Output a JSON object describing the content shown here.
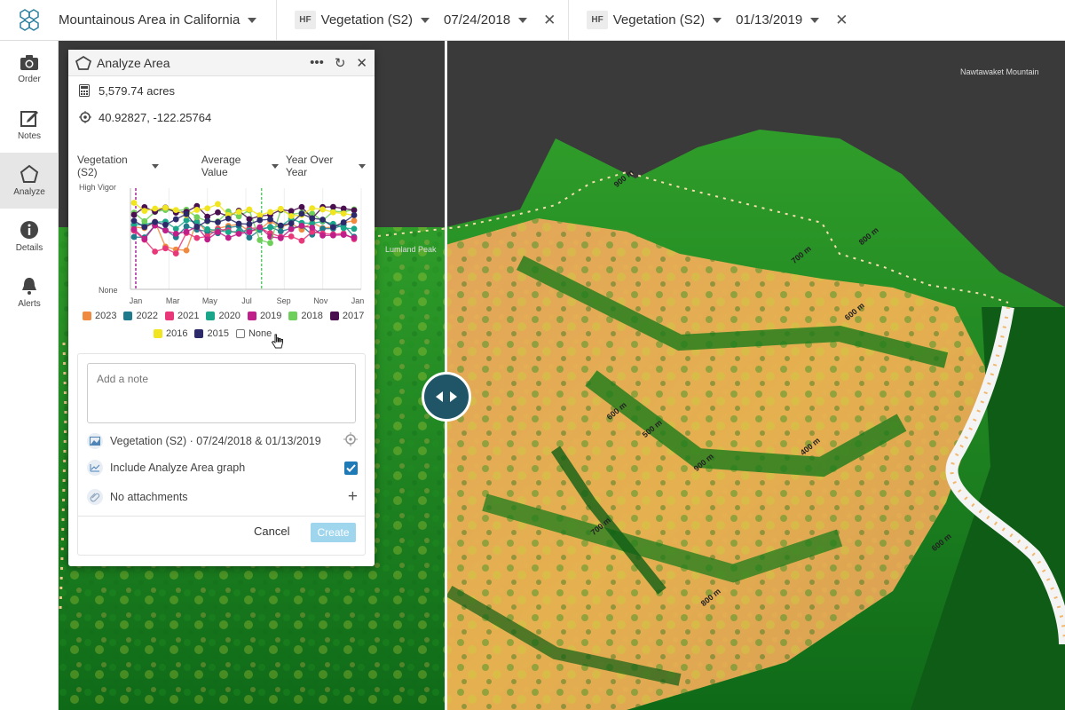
{
  "topbar": {
    "area_name": "Mountainous Area in California",
    "layers": [
      {
        "tag": "HF",
        "name": "Vegetation (S2)",
        "date": "07/24/2018"
      },
      {
        "tag": "HF",
        "name": "Vegetation (S2)",
        "date": "01/13/2019"
      }
    ]
  },
  "sidenav": {
    "items": [
      {
        "label": "Order",
        "icon": "camera-icon"
      },
      {
        "label": "Notes",
        "icon": "edit-icon"
      },
      {
        "label": "Analyze",
        "icon": "pentagon-icon"
      },
      {
        "label": "Details",
        "icon": "info-icon"
      },
      {
        "label": "Alerts",
        "icon": "bell-icon"
      }
    ]
  },
  "map": {
    "peak_labels": [
      "Nawtawaket Mountain",
      "Lumland Peak"
    ],
    "contours": [
      "900 m",
      "800 m",
      "700 m",
      "600 m",
      "600 m",
      "500 m",
      "400 m",
      "700 m",
      "600 m",
      "800 m",
      "900 m"
    ]
  },
  "panel": {
    "title": "Analyze Area",
    "area": "5,579.74 acres",
    "coords": "40.92827, -122.25764",
    "dropdowns": {
      "layer": "Vegetation (S2)",
      "metric": "Average Value",
      "mode": "Year Over Year"
    },
    "note_placeholder": "Add a note",
    "layer_summary": "Vegetation (S2) · 07/24/2018 & 01/13/2019",
    "include_graph_label": "Include Analyze Area graph",
    "include_graph_checked": true,
    "attachments_label": "No attachments",
    "cancel_label": "Cancel",
    "create_label": "Create"
  },
  "chart_data": {
    "type": "scatter",
    "ylabel_top": "High Vigor",
    "ylabel_bottom": "None",
    "x_ticks": [
      "Jan",
      "Mar",
      "May",
      "Jul",
      "Sep",
      "Nov",
      "Jan"
    ],
    "markers": [
      {
        "color": "#a6289b",
        "at": "Jan 24"
      },
      {
        "color": "#5bc96b",
        "at": "Jul 24"
      }
    ],
    "legend": [
      {
        "name": "2023",
        "color": "#f08a3e"
      },
      {
        "name": "2022",
        "color": "#1f7a8c"
      },
      {
        "name": "2021",
        "color": "#e8387a"
      },
      {
        "name": "2020",
        "color": "#1aa68a"
      },
      {
        "name": "2019",
        "color": "#c01f8a"
      },
      {
        "name": "2018",
        "color": "#6fcf5b"
      },
      {
        "name": "2017",
        "color": "#4a0f4f"
      },
      {
        "name": "2016",
        "color": "#f0e520"
      },
      {
        "name": "2015",
        "color": "#2d2a6b"
      },
      {
        "name": "None",
        "color": "#ffffff"
      }
    ]
  }
}
